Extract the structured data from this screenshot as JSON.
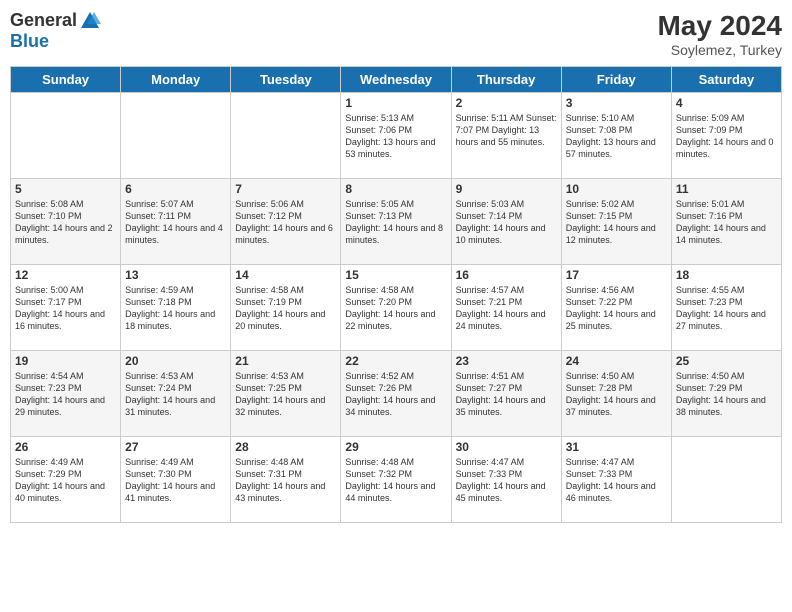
{
  "header": {
    "logo_line1": "General",
    "logo_line2": "Blue",
    "month": "May 2024",
    "location": "Soylemez, Turkey"
  },
  "days_of_week": [
    "Sunday",
    "Monday",
    "Tuesday",
    "Wednesday",
    "Thursday",
    "Friday",
    "Saturday"
  ],
  "weeks": [
    [
      {
        "day": "",
        "info": ""
      },
      {
        "day": "",
        "info": ""
      },
      {
        "day": "",
        "info": ""
      },
      {
        "day": "1",
        "info": "Sunrise: 5:13 AM\nSunset: 7:06 PM\nDaylight: 13 hours and 53 minutes."
      },
      {
        "day": "2",
        "info": "Sunrise: 5:11 AM\nSunset: 7:07 PM\nDaylight: 13 hours and 55 minutes."
      },
      {
        "day": "3",
        "info": "Sunrise: 5:10 AM\nSunset: 7:08 PM\nDaylight: 13 hours and 57 minutes."
      },
      {
        "day": "4",
        "info": "Sunrise: 5:09 AM\nSunset: 7:09 PM\nDaylight: 14 hours and 0 minutes."
      }
    ],
    [
      {
        "day": "5",
        "info": "Sunrise: 5:08 AM\nSunset: 7:10 PM\nDaylight: 14 hours and 2 minutes."
      },
      {
        "day": "6",
        "info": "Sunrise: 5:07 AM\nSunset: 7:11 PM\nDaylight: 14 hours and 4 minutes."
      },
      {
        "day": "7",
        "info": "Sunrise: 5:06 AM\nSunset: 7:12 PM\nDaylight: 14 hours and 6 minutes."
      },
      {
        "day": "8",
        "info": "Sunrise: 5:05 AM\nSunset: 7:13 PM\nDaylight: 14 hours and 8 minutes."
      },
      {
        "day": "9",
        "info": "Sunrise: 5:03 AM\nSunset: 7:14 PM\nDaylight: 14 hours and 10 minutes."
      },
      {
        "day": "10",
        "info": "Sunrise: 5:02 AM\nSunset: 7:15 PM\nDaylight: 14 hours and 12 minutes."
      },
      {
        "day": "11",
        "info": "Sunrise: 5:01 AM\nSunset: 7:16 PM\nDaylight: 14 hours and 14 minutes."
      }
    ],
    [
      {
        "day": "12",
        "info": "Sunrise: 5:00 AM\nSunset: 7:17 PM\nDaylight: 14 hours and 16 minutes."
      },
      {
        "day": "13",
        "info": "Sunrise: 4:59 AM\nSunset: 7:18 PM\nDaylight: 14 hours and 18 minutes."
      },
      {
        "day": "14",
        "info": "Sunrise: 4:58 AM\nSunset: 7:19 PM\nDaylight: 14 hours and 20 minutes."
      },
      {
        "day": "15",
        "info": "Sunrise: 4:58 AM\nSunset: 7:20 PM\nDaylight: 14 hours and 22 minutes."
      },
      {
        "day": "16",
        "info": "Sunrise: 4:57 AM\nSunset: 7:21 PM\nDaylight: 14 hours and 24 minutes."
      },
      {
        "day": "17",
        "info": "Sunrise: 4:56 AM\nSunset: 7:22 PM\nDaylight: 14 hours and 25 minutes."
      },
      {
        "day": "18",
        "info": "Sunrise: 4:55 AM\nSunset: 7:23 PM\nDaylight: 14 hours and 27 minutes."
      }
    ],
    [
      {
        "day": "19",
        "info": "Sunrise: 4:54 AM\nSunset: 7:23 PM\nDaylight: 14 hours and 29 minutes."
      },
      {
        "day": "20",
        "info": "Sunrise: 4:53 AM\nSunset: 7:24 PM\nDaylight: 14 hours and 31 minutes."
      },
      {
        "day": "21",
        "info": "Sunrise: 4:53 AM\nSunset: 7:25 PM\nDaylight: 14 hours and 32 minutes."
      },
      {
        "day": "22",
        "info": "Sunrise: 4:52 AM\nSunset: 7:26 PM\nDaylight: 14 hours and 34 minutes."
      },
      {
        "day": "23",
        "info": "Sunrise: 4:51 AM\nSunset: 7:27 PM\nDaylight: 14 hours and 35 minutes."
      },
      {
        "day": "24",
        "info": "Sunrise: 4:50 AM\nSunset: 7:28 PM\nDaylight: 14 hours and 37 minutes."
      },
      {
        "day": "25",
        "info": "Sunrise: 4:50 AM\nSunset: 7:29 PM\nDaylight: 14 hours and 38 minutes."
      }
    ],
    [
      {
        "day": "26",
        "info": "Sunrise: 4:49 AM\nSunset: 7:29 PM\nDaylight: 14 hours and 40 minutes."
      },
      {
        "day": "27",
        "info": "Sunrise: 4:49 AM\nSunset: 7:30 PM\nDaylight: 14 hours and 41 minutes."
      },
      {
        "day": "28",
        "info": "Sunrise: 4:48 AM\nSunset: 7:31 PM\nDaylight: 14 hours and 43 minutes."
      },
      {
        "day": "29",
        "info": "Sunrise: 4:48 AM\nSunset: 7:32 PM\nDaylight: 14 hours and 44 minutes."
      },
      {
        "day": "30",
        "info": "Sunrise: 4:47 AM\nSunset: 7:33 PM\nDaylight: 14 hours and 45 minutes."
      },
      {
        "day": "31",
        "info": "Sunrise: 4:47 AM\nSunset: 7:33 PM\nDaylight: 14 hours and 46 minutes."
      },
      {
        "day": "",
        "info": ""
      }
    ]
  ]
}
